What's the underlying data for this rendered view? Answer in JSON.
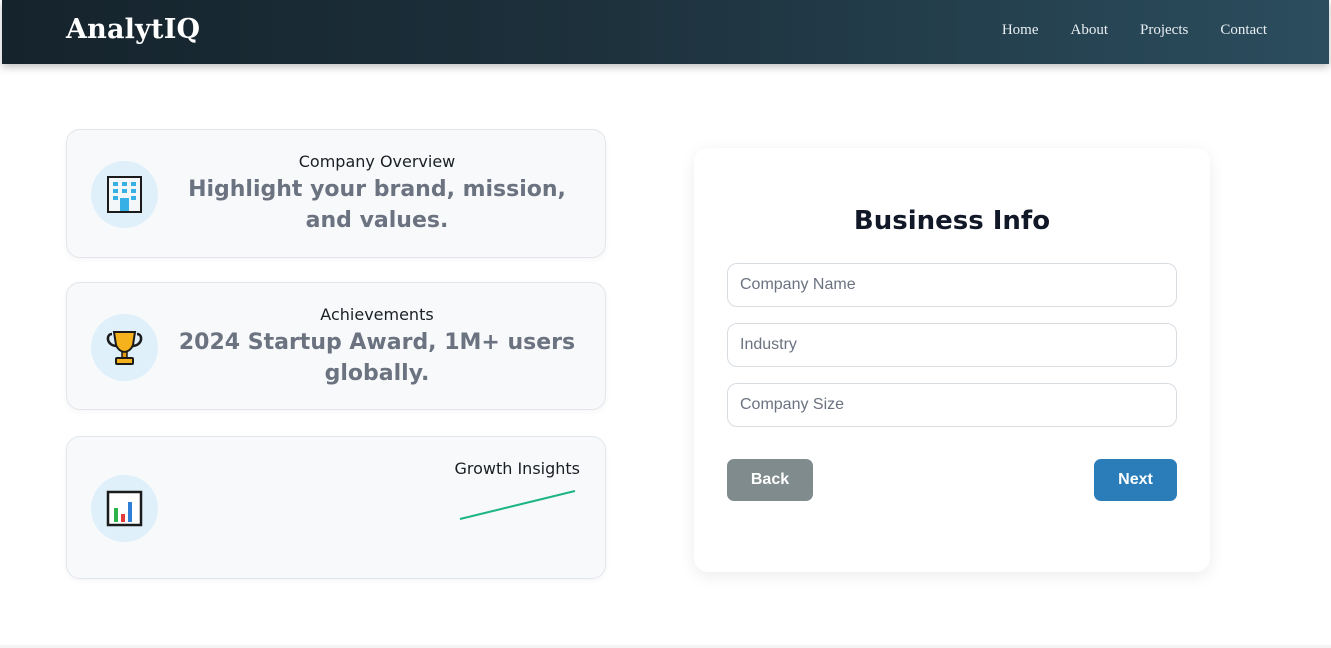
{
  "header": {
    "brand": "AnalytIQ",
    "nav": [
      "Home",
      "About",
      "Projects",
      "Contact"
    ]
  },
  "cards": [
    {
      "icon": "office-building-icon",
      "title": "Company Overview",
      "subtitle": "Highlight your brand, mission, and values."
    },
    {
      "icon": "trophy-icon",
      "title": "Achievements",
      "subtitle": "2024 Startup Award, 1M+ users globally."
    },
    {
      "icon": "bar-chart-icon",
      "title": "Growth Insights",
      "trend_color": "#1db584"
    }
  ],
  "form": {
    "title": "Business Info",
    "fields": [
      {
        "placeholder": "Company Name",
        "value": ""
      },
      {
        "placeholder": "Industry",
        "value": ""
      },
      {
        "placeholder": "Company Size",
        "value": ""
      }
    ],
    "back_label": "Back",
    "next_label": "Next"
  },
  "colors": {
    "header_gradient_start": "#15232c",
    "header_gradient_end": "#2b4d5e",
    "back_button": "#808b8d",
    "next_button": "#2a7db8",
    "icon_circle": "#dff0fb"
  }
}
